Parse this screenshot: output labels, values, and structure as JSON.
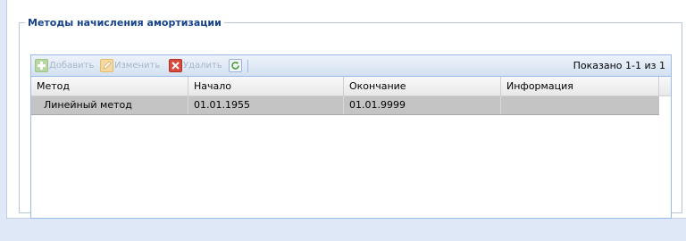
{
  "fieldset": {
    "title": "Методы начисления амортизации"
  },
  "toolbar": {
    "add_label": "Добавить",
    "add_icon": "add-icon",
    "edit_label": "Изменить",
    "edit_icon": "edit-icon",
    "delete_label": "Удалить",
    "delete_icon": "delete-icon",
    "refresh_icon": "refresh-icon",
    "paging_text": "Показано 1-1 из 1",
    "buttons_disabled": true
  },
  "grid": {
    "columns": [
      "Метод",
      "Начало",
      "Окончание",
      "Информация"
    ],
    "rows": [
      [
        "Линейный метод",
        "01.01.1955",
        "01.01.9999",
        ""
      ]
    ]
  },
  "colors": {
    "legend": "#15428b",
    "grid_border": "#99bbe8",
    "selected_row": "#c4c4c4"
  }
}
